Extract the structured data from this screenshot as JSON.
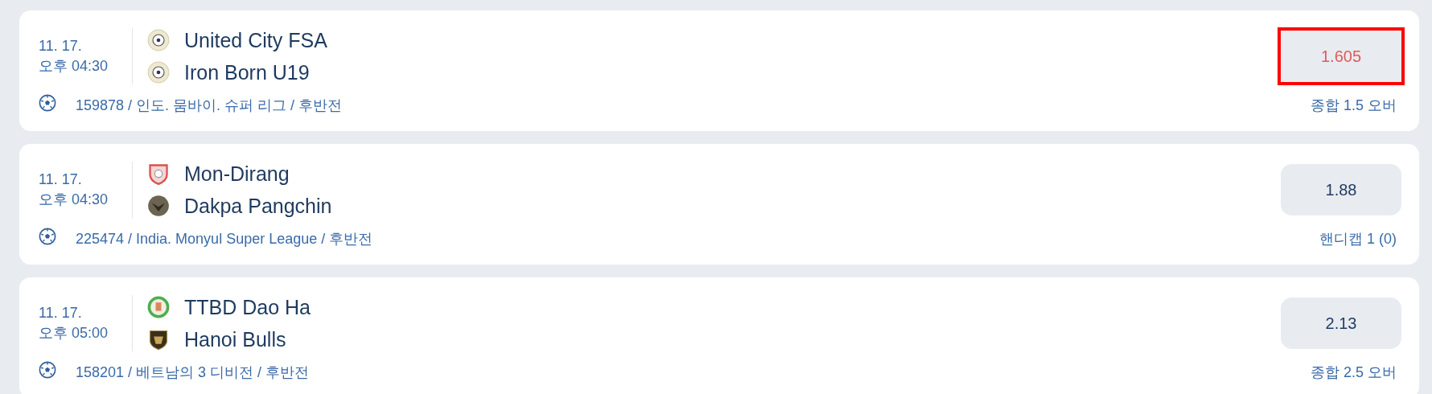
{
  "events": [
    {
      "date": "11. 17.",
      "time": "오후 04:30",
      "teams": [
        {
          "name": "United City FSA"
        },
        {
          "name": "Iron Born U19"
        }
      ],
      "info": "159878 / 인도. 뭄바이. 슈퍼 리그 / 후반전",
      "odds": "1.605",
      "odds_dropped": true,
      "marked": true,
      "market": "종합 1.5 오버"
    },
    {
      "date": "11. 17.",
      "time": "오후 04:30",
      "teams": [
        {
          "name": "Mon-Dirang"
        },
        {
          "name": "Dakpa Pangchin"
        }
      ],
      "info": "225474 / India. Monyul Super League / 후반전",
      "odds": "1.88",
      "odds_dropped": false,
      "marked": false,
      "market": "핸디캡 1 (0)"
    },
    {
      "date": "11. 17.",
      "time": "오후 05:00",
      "teams": [
        {
          "name": "TTBD Dao Ha"
        },
        {
          "name": "Hanoi Bulls"
        }
      ],
      "info": "158201 / 베트남의 3 디비전 / 후반전",
      "odds": "2.13",
      "odds_dropped": false,
      "marked": false,
      "market": "종합 2.5 오버"
    }
  ]
}
